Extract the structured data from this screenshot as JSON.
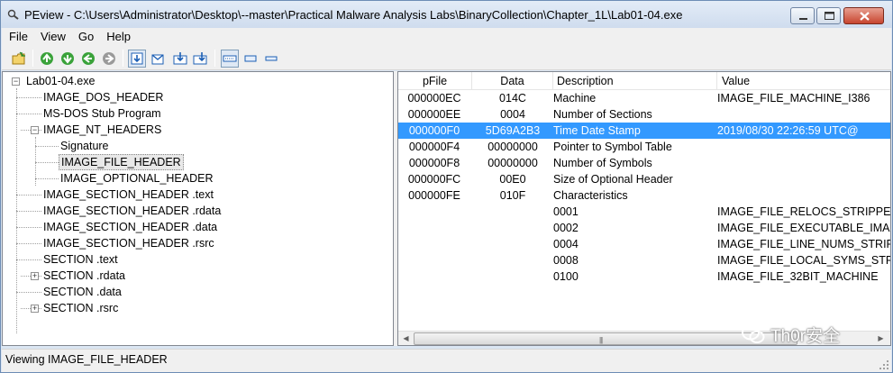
{
  "window": {
    "title": "PEview - C:\\Users\\Administrator\\Desktop\\--master\\Practical Malware Analysis Labs\\BinaryCollection\\Chapter_1L\\Lab01-04.exe"
  },
  "menu": [
    "File",
    "View",
    "Go",
    "Help"
  ],
  "toolbar": {
    "icons": [
      "open-icon",
      "back-icon",
      "forward-icon",
      "up-icon",
      "next-icon",
      "view-byte-icon",
      "view-word-icon",
      "view-dword-icon",
      "view-qword-icon",
      "save-icon",
      "list-mode-icon",
      "small-icon",
      "medium-icon"
    ]
  },
  "tree": {
    "root": "Lab01-04.exe",
    "items": [
      {
        "label": "IMAGE_DOS_HEADER"
      },
      {
        "label": "MS-DOS Stub Program"
      },
      {
        "label": "IMAGE_NT_HEADERS"
      },
      {
        "label": "Signature"
      },
      {
        "label": "IMAGE_FILE_HEADER"
      },
      {
        "label": "IMAGE_OPTIONAL_HEADER"
      },
      {
        "label": "IMAGE_SECTION_HEADER .text"
      },
      {
        "label": "IMAGE_SECTION_HEADER .rdata"
      },
      {
        "label": "IMAGE_SECTION_HEADER .data"
      },
      {
        "label": "IMAGE_SECTION_HEADER .rsrc"
      },
      {
        "label": "SECTION .text"
      },
      {
        "label": "SECTION .rdata"
      },
      {
        "label": "SECTION .data"
      },
      {
        "label": "SECTION .rsrc"
      }
    ]
  },
  "list": {
    "columns": [
      "pFile",
      "Data",
      "Description",
      "Value"
    ],
    "rows": [
      {
        "pfile": "000000EC",
        "data": "014C",
        "desc": "Machine",
        "value": "IMAGE_FILE_MACHINE_I386"
      },
      {
        "pfile": "000000EE",
        "data": "0004",
        "desc": "Number of Sections",
        "value": ""
      },
      {
        "pfile": "000000F0",
        "data": "5D69A2B3",
        "desc": "Time Date Stamp",
        "value": "2019/08/30  22:26:59 UTC@"
      },
      {
        "pfile": "000000F4",
        "data": "00000000",
        "desc": "Pointer to Symbol Table",
        "value": ""
      },
      {
        "pfile": "000000F8",
        "data": "00000000",
        "desc": "Number of Symbols",
        "value": ""
      },
      {
        "pfile": "000000FC",
        "data": "00E0",
        "desc": "Size of Optional Header",
        "value": ""
      },
      {
        "pfile": "000000FE",
        "data": "010F",
        "desc": "Characteristics",
        "value": ""
      },
      {
        "pfile": "",
        "data": "",
        "desc": "0001",
        "value": "IMAGE_FILE_RELOCS_STRIPPED"
      },
      {
        "pfile": "",
        "data": "",
        "desc": "0002",
        "value": "IMAGE_FILE_EXECUTABLE_IMAGE"
      },
      {
        "pfile": "",
        "data": "",
        "desc": "0004",
        "value": "IMAGE_FILE_LINE_NUMS_STRIPPED"
      },
      {
        "pfile": "",
        "data": "",
        "desc": "0008",
        "value": "IMAGE_FILE_LOCAL_SYMS_STRIPPED"
      },
      {
        "pfile": "",
        "data": "",
        "desc": "0100",
        "value": "IMAGE_FILE_32BIT_MACHINE"
      }
    ]
  },
  "watermark": "Th0r安全",
  "status": "Viewing IMAGE_FILE_HEADER",
  "colors": {
    "selection": "#3399ff",
    "titlebar": "#dbe6f3"
  }
}
